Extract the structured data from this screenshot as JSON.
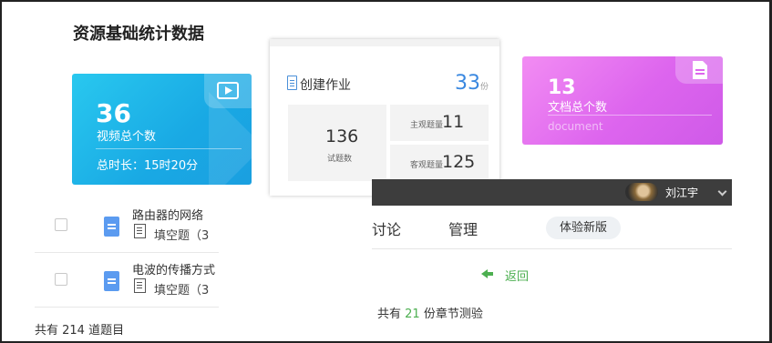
{
  "heading": "资源基础统计数据",
  "video_card": {
    "count": "36",
    "label": "视频总个数",
    "duration": "总时长：15时20分",
    "color": "#1fb5ea"
  },
  "homework_card": {
    "title": "创建作业",
    "count": "33",
    "unit": "份",
    "total_value": "136",
    "total_label": "试题数",
    "subjective_label": "主观题量",
    "subjective_value": "11",
    "objective_label": "客观题量",
    "objective_value": "125",
    "accent": "#3a88e0"
  },
  "doc_card": {
    "count": "13",
    "label": "文档总个数",
    "sub": "document",
    "color": "#dd65ee"
  },
  "question_list": {
    "items": [
      {
        "title": "路由器的网络",
        "type": "填空题（3"
      },
      {
        "title": "电波的传播方式",
        "type": "填空题（3"
      }
    ],
    "total": "共有 214 道题目"
  },
  "course_panel": {
    "user_name": "刘江宇",
    "nav": [
      "讨论",
      "管理"
    ],
    "new_version": "体验新版",
    "back": "返回",
    "summary_prefix": "共有",
    "summary_count": "21",
    "summary_suffix": "份章节测验",
    "accent": "#4caf50"
  }
}
